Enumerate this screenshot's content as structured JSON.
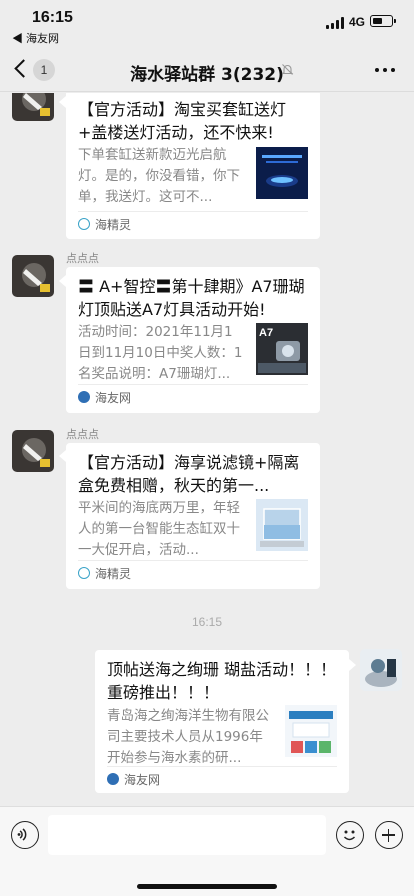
{
  "status_bar": {
    "time": "16:15",
    "back_app": "◀ 海友网",
    "network": "4G"
  },
  "nav": {
    "unread_count": "1",
    "title": "海水驿站群 3(232)"
  },
  "messages": [
    {
      "sender": "",
      "title": "【官方活动】淘宝买套缸送灯+盖楼送灯活动，还不快来!",
      "description": "下单套缸送新款迈光启航灯。是的，你没看错，你下单，我送灯。这可不...",
      "source": "海精灵"
    },
    {
      "sender": "点点点",
      "title": "〓 A+智控〓第十肆期》A7珊瑚灯顶贴送A7灯具活动开始!",
      "description": "活动时间：2021年11月1日到11月10日中奖人数：1名奖品说明：A7珊瑚灯...",
      "source": "海友网"
    },
    {
      "sender": "点点点",
      "title": "【官方活动】海享说滤镜+隔离盒免费相赠，秋天的第一...",
      "description": "平米间的海底两万里，年轻人的第一台智能生态缸双十一大促开启，活动...",
      "source": "海精灵"
    },
    {
      "sender": "",
      "title": "顶帖送海之绚珊 瑚盐活动！！！ 重磅推出！！！",
      "description": "青岛海之绚海洋生物有限公司主要技术人员从1996年开始参与海水素的研...",
      "source": "海友网"
    }
  ],
  "timestamp": "16:15",
  "thumb_text": {
    "a7": "A7"
  },
  "colors": {
    "background": "#ededed",
    "bubble": "#ffffff",
    "meta_gray": "#888888"
  }
}
